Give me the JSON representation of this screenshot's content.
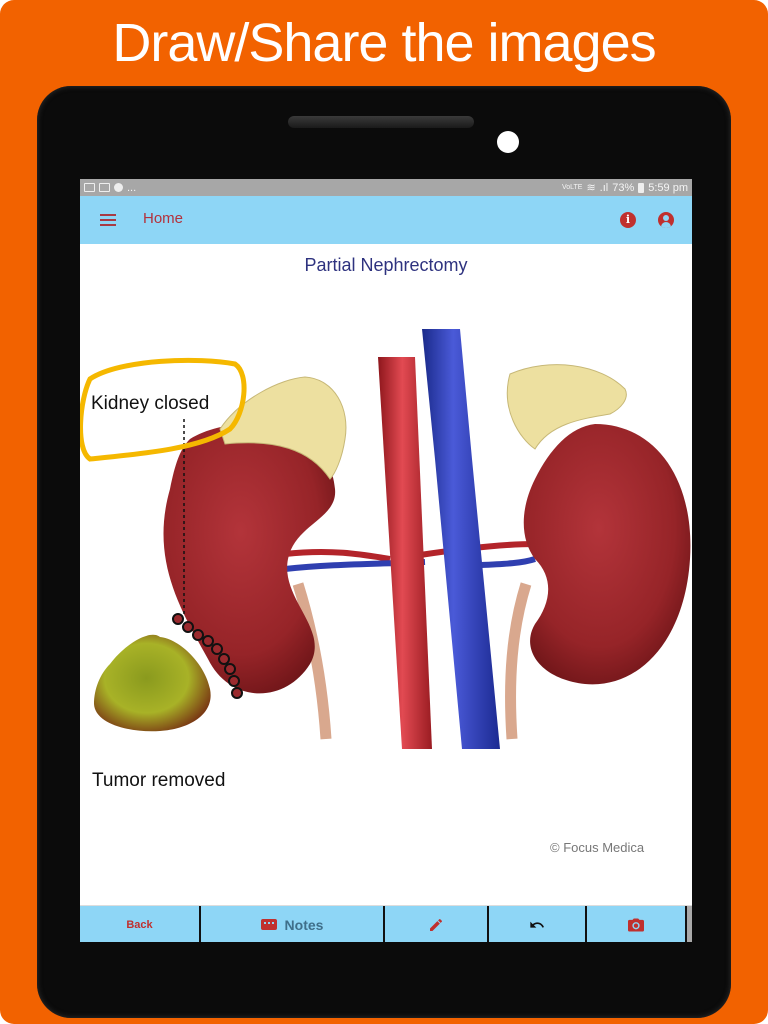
{
  "promo": {
    "headline": "Draw/Share the images",
    "background_color": "#f26200"
  },
  "status_bar": {
    "left_icons": [
      "image-notification-icon",
      "gmail-icon",
      "messenger-icon"
    ],
    "overflow": "...",
    "network": "VoLTE",
    "battery": "73%",
    "time": "5:59 pm"
  },
  "app_bar": {
    "title": "Home",
    "menu_icon": "hamburger-menu-icon",
    "actions": [
      "info-icon",
      "account-icon"
    ],
    "background_color": "#8ed6f6",
    "accent_color": "#c0302e"
  },
  "content": {
    "title": "Partial Nephrectomy",
    "annotation_label": "Kidney closed",
    "tumor_label": "Tumor removed",
    "copyright": "© Focus Medica",
    "highlight_color": "#f5b800"
  },
  "bottom_bar": {
    "back_label": "Back",
    "notes_label": "Notes",
    "notes_icon": "keyboard-icon",
    "draw_icon": "pencil-icon",
    "undo_icon": "undo-icon",
    "photo_icon": "camera-icon"
  }
}
